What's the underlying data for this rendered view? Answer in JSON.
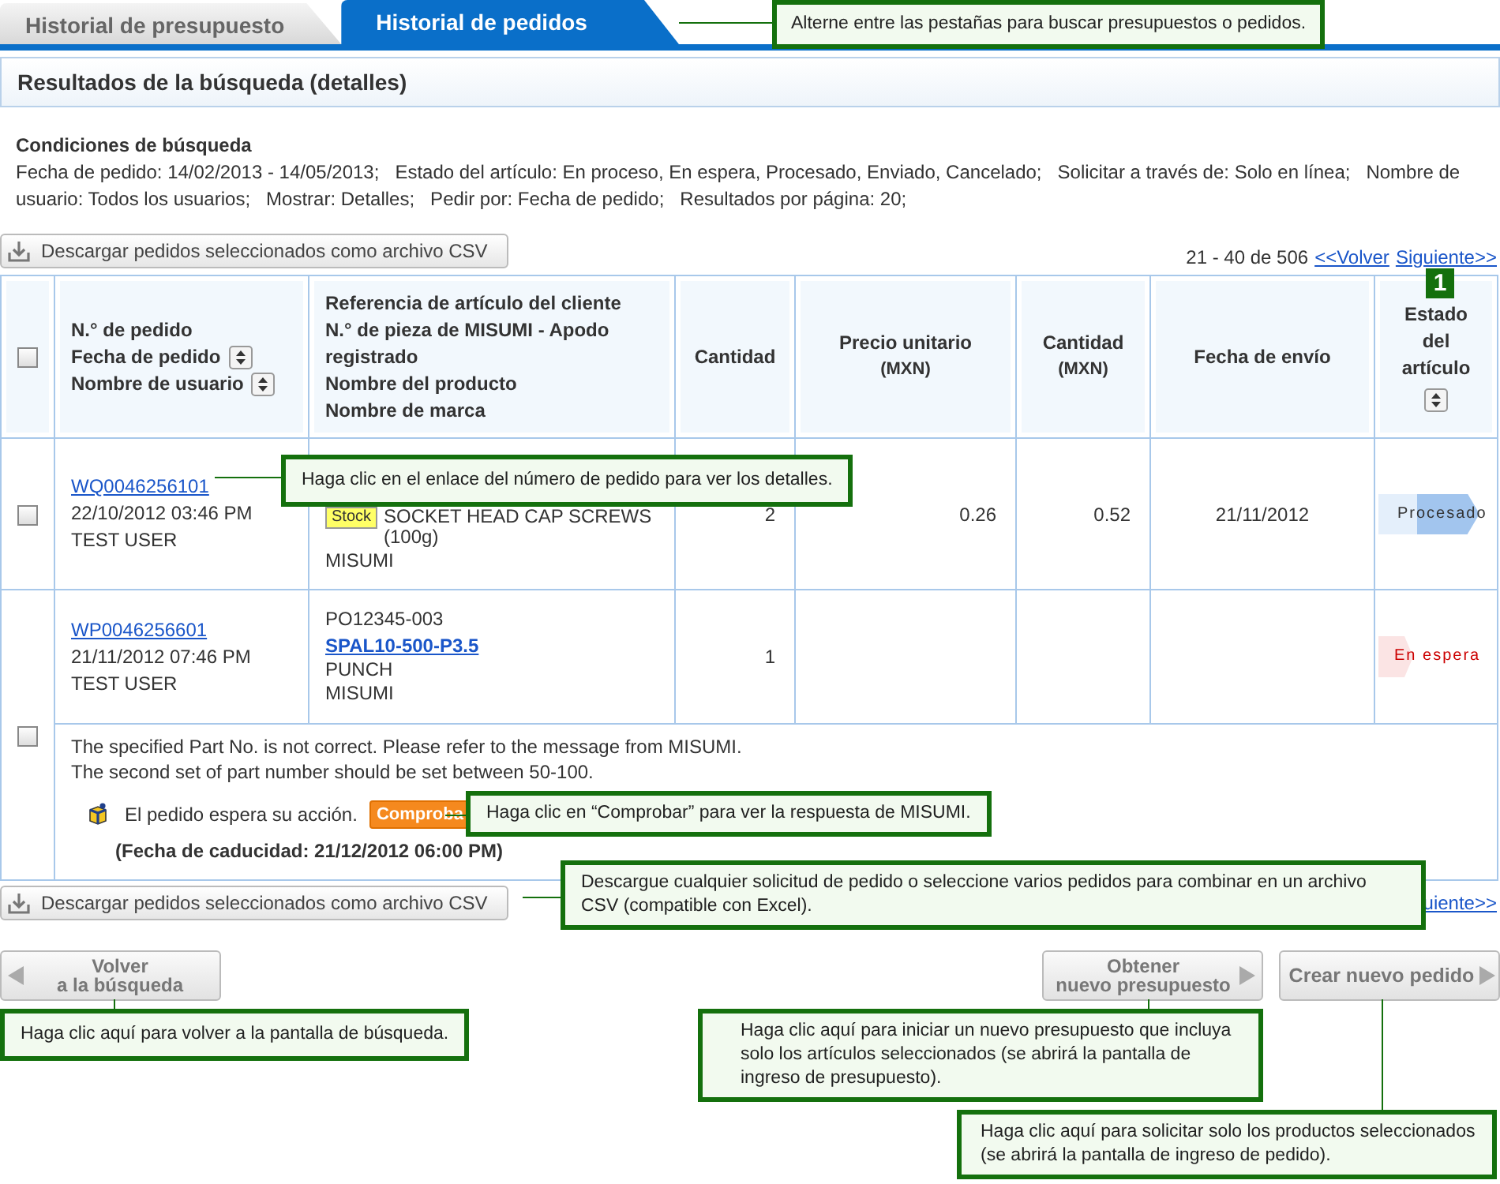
{
  "tabs": [
    {
      "label": "Historial de presupuesto",
      "selected": false
    },
    {
      "label": "Historial de pedidos",
      "selected": true
    }
  ],
  "results_title": "Resultados de la búsqueda (detalles)",
  "search_conditions": {
    "heading": "Condiciones de búsqueda",
    "text": "Fecha de pedido: 14/02/2013 - 14/05/2013;   Estado del artículo: En proceso, En espera, Procesado, Enviado, Cancelado;   Solicitar a través de: Solo en línea;   Nombre de usuario: Todos los usuarios;   Mostrar: Detalles;   Pedir por: Fecha de pedido;   Resultados por página: 20;"
  },
  "csv_button": "Descargar pedidos seleccionados como archivo CSV",
  "pagination": {
    "range": "21 - 40 de 506",
    "prev": "<<Volver",
    "next": "Siguiente>>"
  },
  "table": {
    "select_all": {
      "checked": false
    },
    "columns": [
      {
        "lines": [
          {
            "text": "N.° de pedido",
            "sortable": false
          },
          {
            "text": "Fecha de pedido",
            "sortable": true
          },
          {
            "text": "Nombre de usuario",
            "sortable": true
          }
        ]
      },
      {
        "lines": [
          {
            "text": "Referencia de artículo del cliente",
            "sortable": false
          },
          {
            "text": "N.° de pieza de MISUMI - Apodo registrado",
            "sortable": false
          },
          {
            "text": "Nombre del producto",
            "sortable": false
          },
          {
            "text": "Nombre de marca",
            "sortable": false
          }
        ]
      },
      {
        "lines": [
          {
            "text": "Cantidad",
            "sortable": false
          }
        ]
      },
      {
        "lines": [
          {
            "text": "Precio unitario",
            "unit": "(MXN)",
            "sortable": false
          }
        ]
      },
      {
        "lines": [
          {
            "text": "Cantidad",
            "sortable": false
          },
          {
            "text": "(MXN)",
            "sortable": false
          }
        ]
      },
      {
        "lines": [
          {
            "text": "Fecha de envío",
            "sortable": false
          }
        ]
      },
      {
        "lines": [
          {
            "text": "Estado del artículo",
            "sortable": true
          }
        ]
      }
    ],
    "rows": [
      {
        "checked": false,
        "order_no": "WQ0046256101",
        "date": "22/10/2012 03:46 PM",
        "user": "TEST USER",
        "stock_badge": "Stock",
        "product": "SOCKET HEAD CAP SCREWS (100g)",
        "brand": "MISUMI",
        "quantity": "2",
        "unit_price": "0.26",
        "amount": "0.52",
        "ship_date": "21/11/2012",
        "status": {
          "label": "Procesado",
          "kind": "processed"
        }
      },
      {
        "checked": false,
        "order_no": "WP0046256601",
        "date": "21/11/2012 07:46 PM",
        "user": "TEST USER",
        "customer_ref": "PO12345-003",
        "part_no": "SPAL10-500-P3.5",
        "product": "PUNCH",
        "brand": "MISUMI",
        "quantity": "1",
        "status": {
          "label": "En espera",
          "kind": "on_hold"
        },
        "message": {
          "lines": [
            "The specified Part No. is not correct. Please refer to the message from MISUMI.",
            "The second set of part number should be set between 50-100."
          ],
          "action": "El pedido espera su acción.",
          "button": "Comproba",
          "expiry": "(Fecha de caducidad: 21/12/2012 06:00 PM)"
        }
      }
    ]
  },
  "bottom_csv_button": "Descargar pedidos seleccionados como archivo CSV",
  "bottom_pagination": {
    "next": "uiente>>"
  },
  "buttons": [
    {
      "lines": [
        "Volver",
        "a la búsqueda"
      ],
      "kind": "back"
    },
    {
      "lines": [
        "Obtener",
        "nuevo presupuesto"
      ],
      "kind": "forward"
    },
    {
      "lines": [
        "Crear nuevo pedido"
      ],
      "kind": "forward"
    }
  ],
  "marker": "1",
  "callouts": [
    {
      "kind": "tabs",
      "text": "Alterne entre las pestañas para buscar presupuestos o pedidos."
    },
    {
      "kind": "order",
      "text": "Haga clic en el enlace del número de pedido para ver los detalles."
    },
    {
      "kind": "check",
      "text": "Haga clic en “Comprobar” para ver la respuesta de MISUMI."
    },
    {
      "kind": "csv",
      "text": "Descargue cualquier solicitud de pedido o seleccione varios pedidos para combinar en un archivo CSV (compatible con Excel)."
    },
    {
      "kind": "back",
      "text": "Haga clic aquí para volver a la pantalla de búsqueda."
    },
    {
      "kind": "quote",
      "text": "Haga clic aquí para iniciar un nuevo presupuesto que incluya solo los artículos seleccionados (se abrirá la pantalla de ingreso de presupuesto)."
    },
    {
      "kind": "order_new",
      "text": "Haga clic aquí para solicitar solo los productos seleccionados (se abrirá la pantalla de ingreso de pedido)."
    }
  ]
}
